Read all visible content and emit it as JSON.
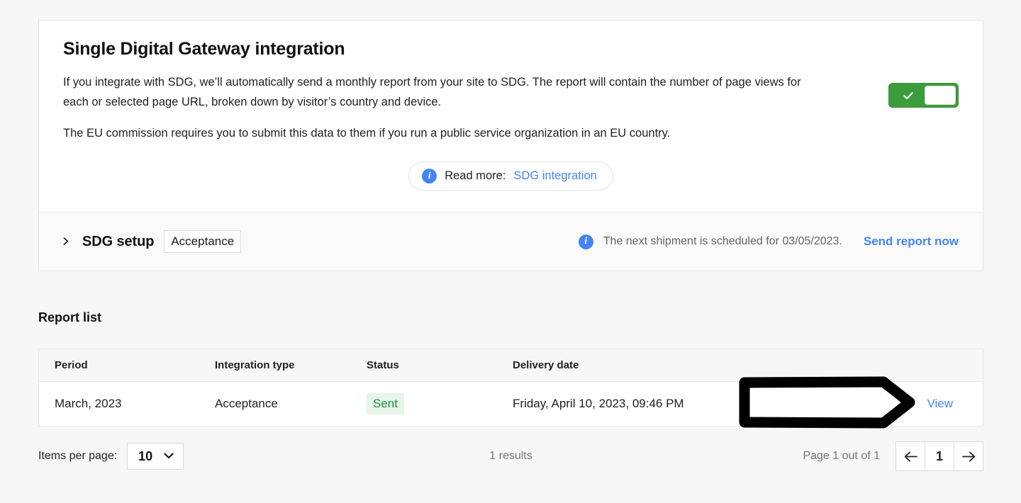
{
  "sdg_card": {
    "title": "Single Digital Gateway integration",
    "paragraph1": "If you integrate with SDG, we’ll automatically send a monthly report from your site to SDG. The report will contain the number of page views for each or selected page URL, broken down by visitor’s country and device.",
    "paragraph2": "The EU commission requires you to submit this data to them if you run a public service organization in an EU country.",
    "toggle": {
      "state": "on",
      "icon": "check-icon",
      "color": "#3c9c3c"
    },
    "read_more": {
      "icon": "info-icon",
      "label": "Read more:",
      "link_text": "SDG integration",
      "link_color": "#4285f4"
    }
  },
  "sdg_setup": {
    "chevron_icon": "chevron-right-icon",
    "title": "SDG setup",
    "badge": "Acceptance",
    "info_icon": "info-icon",
    "note": "The next shipment is scheduled for 03/05/2023.",
    "action_label": "Send report now",
    "action_color": "#4285f4"
  },
  "report_list": {
    "heading": "Report list",
    "columns": [
      "Period",
      "Integration type",
      "Status",
      "Delivery date",
      ""
    ],
    "rows": [
      {
        "period": "March, 2023",
        "integration_type": "Acceptance",
        "status": "Sent",
        "status_color": "#1e8e3e",
        "status_bg": "#e6f4ea",
        "delivery_date": "Friday, April 10, 2023, 09:46 PM",
        "action": "View"
      }
    ]
  },
  "pagination": {
    "items_per_page_label": "Items per page:",
    "items_per_page_value": "10",
    "caret_icon": "chevron-down-icon",
    "results_text": "1 results",
    "page_status": "Page 1 out of 1",
    "prev_icon": "arrow-left-icon",
    "current_page": "1",
    "next_icon": "arrow-right-icon"
  },
  "annotation": {
    "shape": "arrow-right-outline",
    "color": "#000000",
    "target": "View"
  }
}
